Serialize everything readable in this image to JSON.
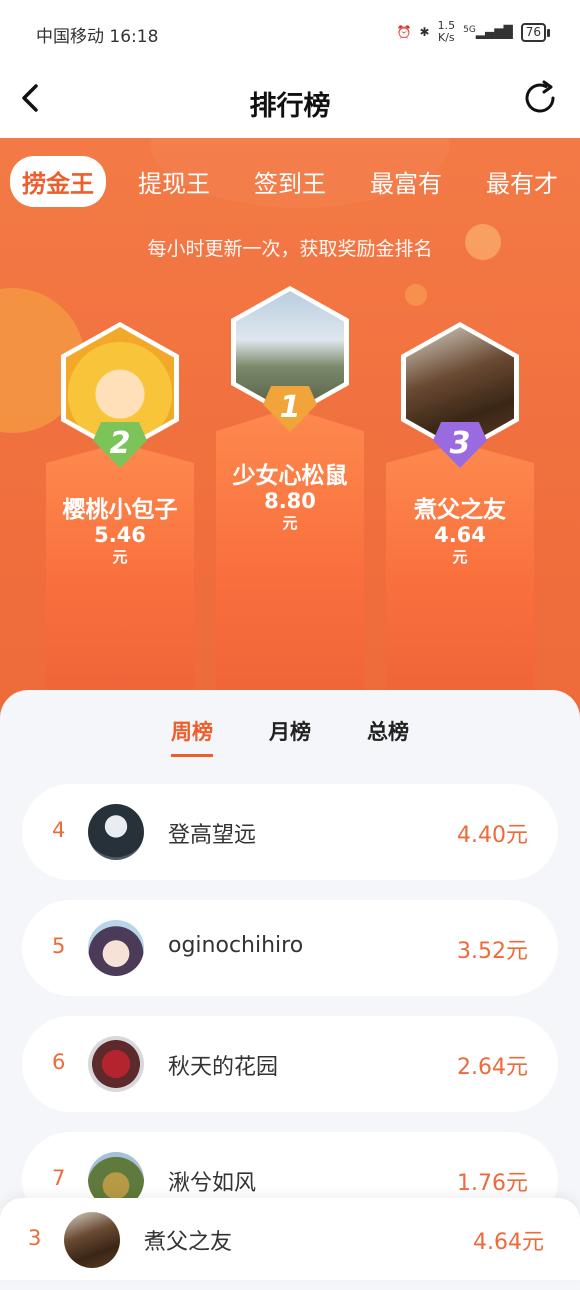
{
  "status": {
    "carrier_time": "中国移动 16:18",
    "speed_top": "1.5",
    "speed_bottom": "K/s",
    "network": "5G",
    "battery": "76"
  },
  "header": {
    "title": "排行榜",
    "back_icon": "back-arrow-icon",
    "refresh_icon": "refresh-icon"
  },
  "tabs": [
    {
      "label": "捞金王",
      "active": true
    },
    {
      "label": "提现王"
    },
    {
      "label": "签到王"
    },
    {
      "label": "最富有"
    },
    {
      "label": "最有才"
    }
  ],
  "subtitle": "每小时更新一次，获取奖励金排名",
  "podium": {
    "first": {
      "rank": "1",
      "name": "少女心松鼠",
      "amount": "8.80",
      "unit": "元"
    },
    "second": {
      "rank": "2",
      "name": "樱桃小包子",
      "amount": "5.46",
      "unit": "元"
    },
    "third": {
      "rank": "3",
      "name": "煮父之友",
      "amount": "4.64",
      "unit": "元"
    }
  },
  "period_tabs": [
    {
      "label": "周榜",
      "active": true
    },
    {
      "label": "月榜"
    },
    {
      "label": "总榜"
    }
  ],
  "list": [
    {
      "rank": "4",
      "name": "登高望远",
      "amount": "4.40元"
    },
    {
      "rank": "5",
      "name": "oginochihiro",
      "amount": "3.52元"
    },
    {
      "rank": "6",
      "name": "秋天的花园",
      "amount": "2.64元"
    },
    {
      "rank": "7",
      "name": "湫兮如风",
      "amount": "1.76元"
    }
  ],
  "me": {
    "rank": "3",
    "name": "煮父之友",
    "amount": "4.64元"
  },
  "colors": {
    "accent": "#ee5d2c",
    "hero_bg": "#f37a46",
    "medal_gold": "#f0a43a",
    "medal_green": "#7cc35a",
    "medal_purple": "#9a6ae0"
  }
}
